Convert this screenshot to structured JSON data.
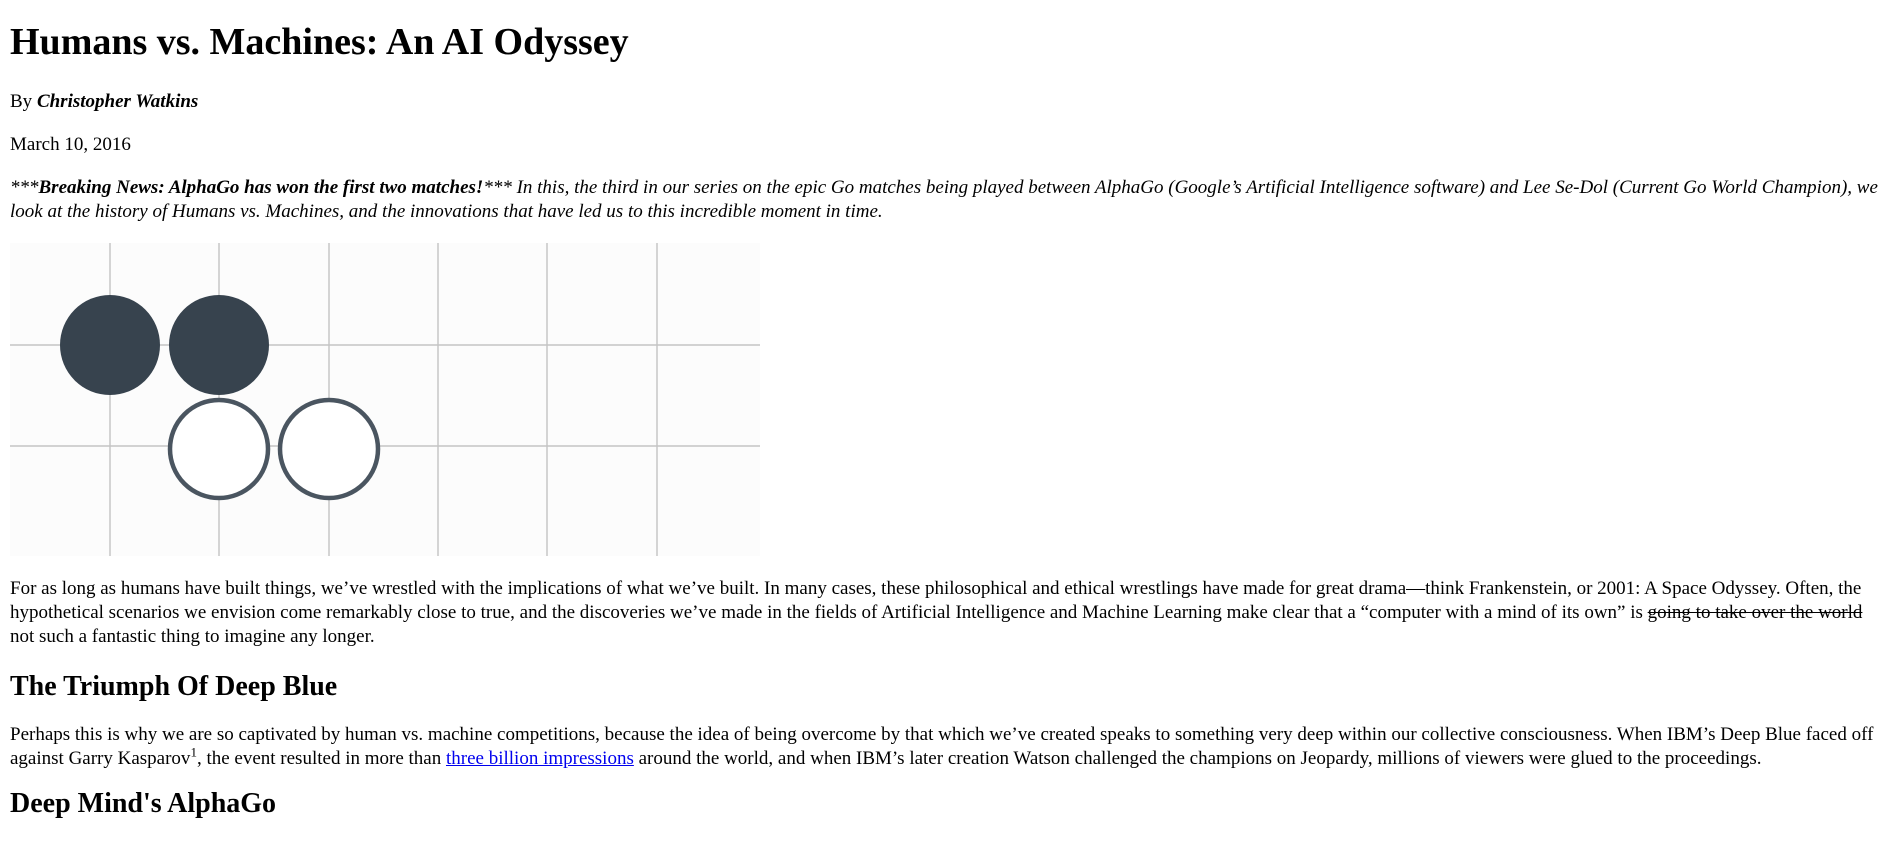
{
  "article": {
    "title": "Humans vs. Machines: An AI Odyssey",
    "byline_prefix": "By ",
    "author": "Christopher Watkins",
    "date": "March 10, 2016",
    "intro_marker_open": "***",
    "intro_bold": "Breaking News: AlphaGo has won the first two matches!",
    "intro_marker_close": "***",
    "intro_text": " In this, the third in our series on the epic Go matches being played between AlphaGo (Google’s Artificial Intelligence software) and Lee Se-Dol (Current Go World Champion), we look at the history of Humans vs. Machines, and the innovations that have led us to this incredible moment in time.",
    "para1_start": "For as long as humans have built things, we’ve wrestled with the implications of what we’ve built. In many cases, these philosophical and ethical wrestlings have made for great drama—think Frankenstein, or 2001: A Space Odyssey. Often, the hypothetical scenarios we envision come remarkably close to true, and the discoveries we’ve made in the fields of Artificial Intelligence and Machine Learning make clear that a “computer with a mind of its own” is ",
    "para1_strike": "going to take over the world",
    "para1_end": " not such a fantastic thing to imagine any longer.",
    "section1_heading": "The Triumph Of Deep Blue",
    "para2_start": "Perhaps this is why we are so captivated by human vs. machine competitions, because the idea of being overcome by that which we’ve created speaks to something very deep within our collective consciousness. When IBM’s Deep Blue faced off against Garry Kasparov",
    "para2_footnote": "1",
    "para2_mid": ", the event resulted in more than ",
    "para2_link": "three billion impressions",
    "para2_end": " around the world, and when IBM’s later creation Watson challenged the champions on Jeopardy, millions of viewers were glued to the proceedings.",
    "section2_heading": "Deep Mind's AlphaGo"
  },
  "figure": {
    "icon": "go-board-illustration",
    "board_color": "#fcfcfc",
    "line_color": "#c4c4c4",
    "black_stone_color": "#37434e",
    "white_stone_stroke": "#4a5560"
  }
}
